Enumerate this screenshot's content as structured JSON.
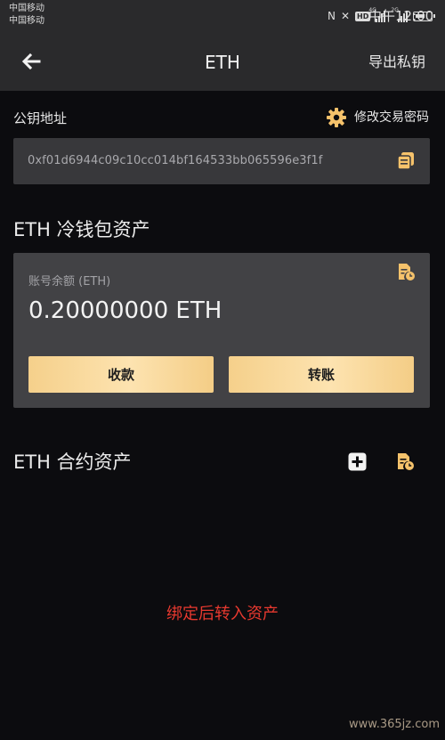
{
  "statusbar": {
    "carrier1": "中国移动",
    "carrier2": "中国移动",
    "hd": "HD",
    "sig1_tag": "4G",
    "sig2_tag": "2G",
    "time": "中午12:00"
  },
  "header": {
    "title": "ETH",
    "export_label": "导出私钥"
  },
  "public_key": {
    "label": "公钥地址",
    "change_password_label": "修改交易密码",
    "address": "0xf01d6944c09c10cc014bf164533bb065596e3f1f"
  },
  "cold_wallet": {
    "title": "ETH 冷钱包资产",
    "balance_label": "账号余额 (ETH)",
    "balance_value": "0.20000000 ETH",
    "receive_label": "收款",
    "transfer_label": "转账"
  },
  "contract": {
    "title": "ETH 合约资产",
    "empty_hint": "绑定后转入资产"
  },
  "watermark": "www.365jz.com",
  "colors": {
    "accent": "#f5c26b",
    "hint_red": "#e8392f",
    "background": "#0c0c0f",
    "card": "#424245"
  },
  "icons": [
    "back-arrow-icon",
    "gear-icon",
    "copy-icon",
    "record-icon",
    "add-icon"
  ]
}
